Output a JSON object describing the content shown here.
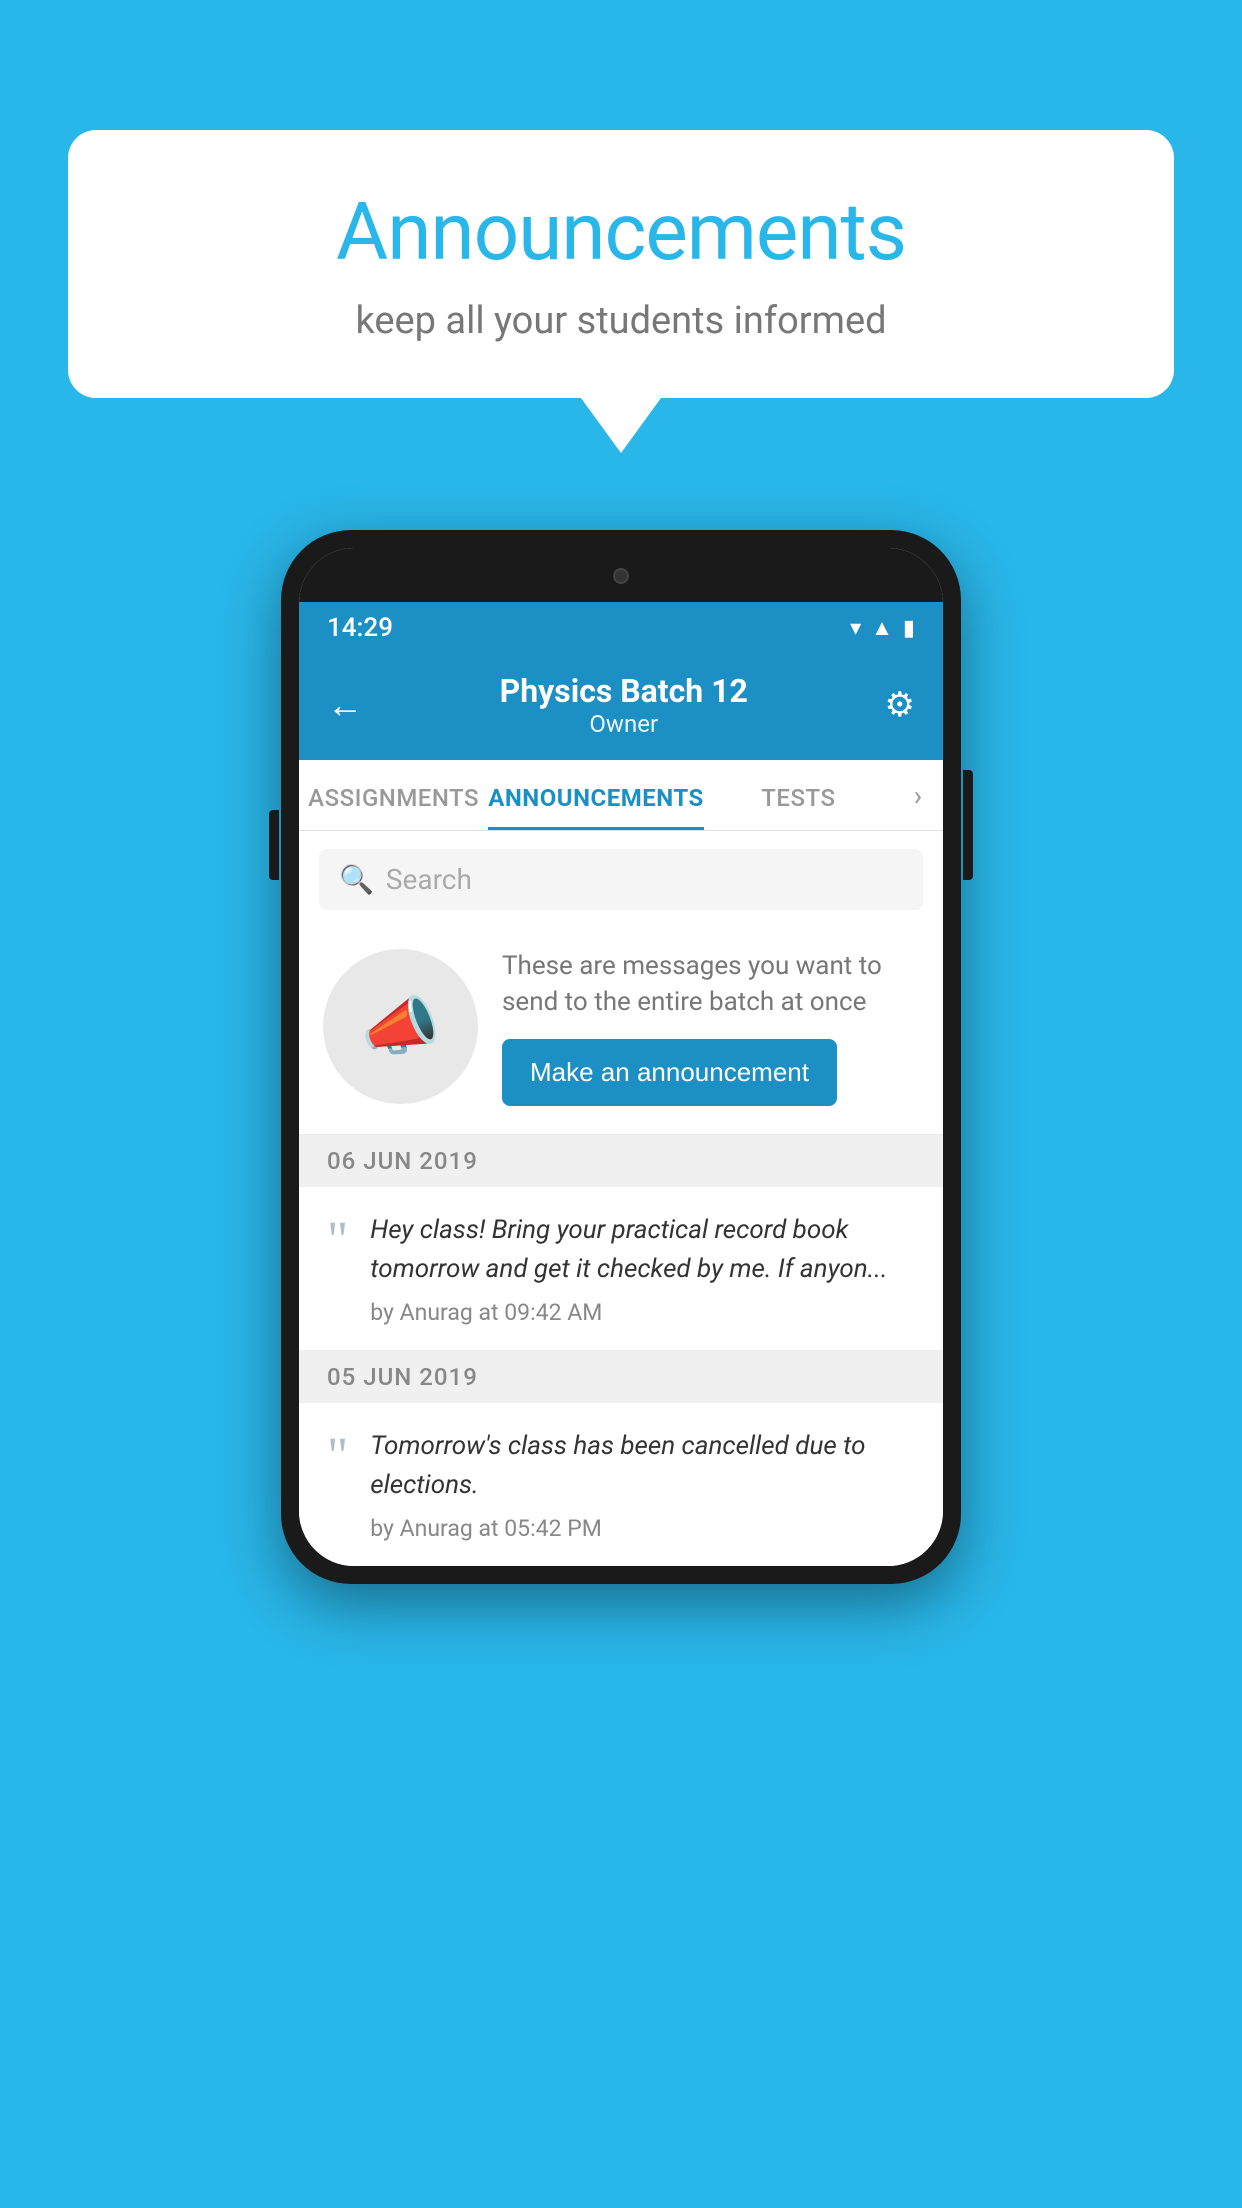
{
  "background_color": "#29b6e8",
  "speech_bubble": {
    "title": "Announcements",
    "subtitle": "keep all your students informed"
  },
  "phone": {
    "status_bar": {
      "time": "14:29",
      "icons": [
        "wifi",
        "signal",
        "battery"
      ]
    },
    "header": {
      "title": "Physics Batch 12",
      "subtitle": "Owner",
      "back_label": "←",
      "gear_label": "⚙"
    },
    "tabs": [
      {
        "label": "ASSIGNMENTS",
        "active": false
      },
      {
        "label": "ANNOUNCEMENTS",
        "active": true
      },
      {
        "label": "TESTS",
        "active": false
      }
    ],
    "search": {
      "placeholder": "Search"
    },
    "promo": {
      "description": "These are messages you want to send to the entire batch at once",
      "button_label": "Make an announcement"
    },
    "announcements": [
      {
        "date": "06  JUN  2019",
        "text": "Hey class! Bring your practical record book tomorrow and get it checked by me. If anyon...",
        "meta": "by Anurag at 09:42 AM"
      },
      {
        "date": "05  JUN  2019",
        "text": "Tomorrow's class has been cancelled due to elections.",
        "meta": "by Anurag at 05:42 PM"
      }
    ]
  }
}
